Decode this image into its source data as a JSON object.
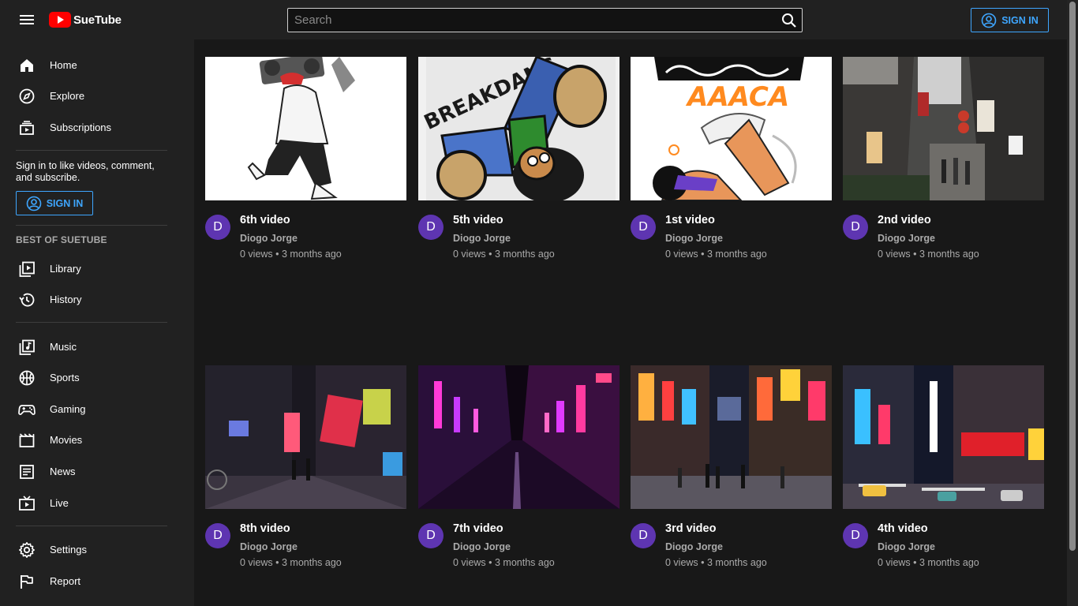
{
  "header": {
    "logo_text": "SueTube",
    "search_placeholder": "Search",
    "signin_label": "SIGN IN"
  },
  "sidebar": {
    "primary": [
      {
        "label": "Home",
        "icon": "home-icon"
      },
      {
        "label": "Explore",
        "icon": "compass-icon"
      },
      {
        "label": "Subscriptions",
        "icon": "subscriptions-icon"
      }
    ],
    "signin_prompt": "Sign in to like videos, comment, and subscribe.",
    "signin_label": "SIGN IN",
    "section_title": "BEST OF SUETUBE",
    "library": [
      {
        "label": "Library",
        "icon": "library-icon"
      },
      {
        "label": "History",
        "icon": "history-icon"
      }
    ],
    "categories": [
      {
        "label": "Music",
        "icon": "music-icon"
      },
      {
        "label": "Sports",
        "icon": "sports-icon"
      },
      {
        "label": "Gaming",
        "icon": "gaming-icon"
      },
      {
        "label": "Movies",
        "icon": "movies-icon"
      },
      {
        "label": "News",
        "icon": "news-icon"
      },
      {
        "label": "Live",
        "icon": "live-icon"
      }
    ],
    "settings": [
      {
        "label": "Settings",
        "icon": "gear-icon"
      },
      {
        "label": "Report",
        "icon": "flag-icon"
      }
    ]
  },
  "videos": [
    {
      "title": "6th video",
      "channel": "Diogo Jorge",
      "meta": "0 views • 3 months ago",
      "avatar": "D",
      "thumb": "boombox-dancer-illustration"
    },
    {
      "title": "5th video",
      "channel": "Diogo Jorge",
      "meta": "0 views • 3 months ago",
      "avatar": "D",
      "thumb": "breakdance-cartoon"
    },
    {
      "title": "1st video",
      "channel": "Diogo Jorge",
      "meta": "0 views • 3 months ago",
      "avatar": "D",
      "thumb": "graffiti-dancer"
    },
    {
      "title": "2nd video",
      "channel": "Diogo Jorge",
      "meta": "0 views • 3 months ago",
      "avatar": "D",
      "thumb": "tokyo-alley-day"
    },
    {
      "title": "8th video",
      "channel": "Diogo Jorge",
      "meta": "0 views • 3 months ago",
      "avatar": "D",
      "thumb": "night-street-neon"
    },
    {
      "title": "7th video",
      "channel": "Diogo Jorge",
      "meta": "0 views • 3 months ago",
      "avatar": "D",
      "thumb": "purple-neon-street"
    },
    {
      "title": "3rd video",
      "channel": "Diogo Jorge",
      "meta": "0 views • 3 months ago",
      "avatar": "D",
      "thumb": "crowded-neon-street"
    },
    {
      "title": "4th video",
      "channel": "Diogo Jorge",
      "meta": "0 views • 3 months ago",
      "avatar": "D",
      "thumb": "shinjuku-crossing"
    }
  ],
  "colors": {
    "accent": "#3ea6ff",
    "brand": "#ff0000",
    "avatar": "#5e35b1",
    "sidebar_bg": "#212121",
    "page_bg": "#181818"
  }
}
